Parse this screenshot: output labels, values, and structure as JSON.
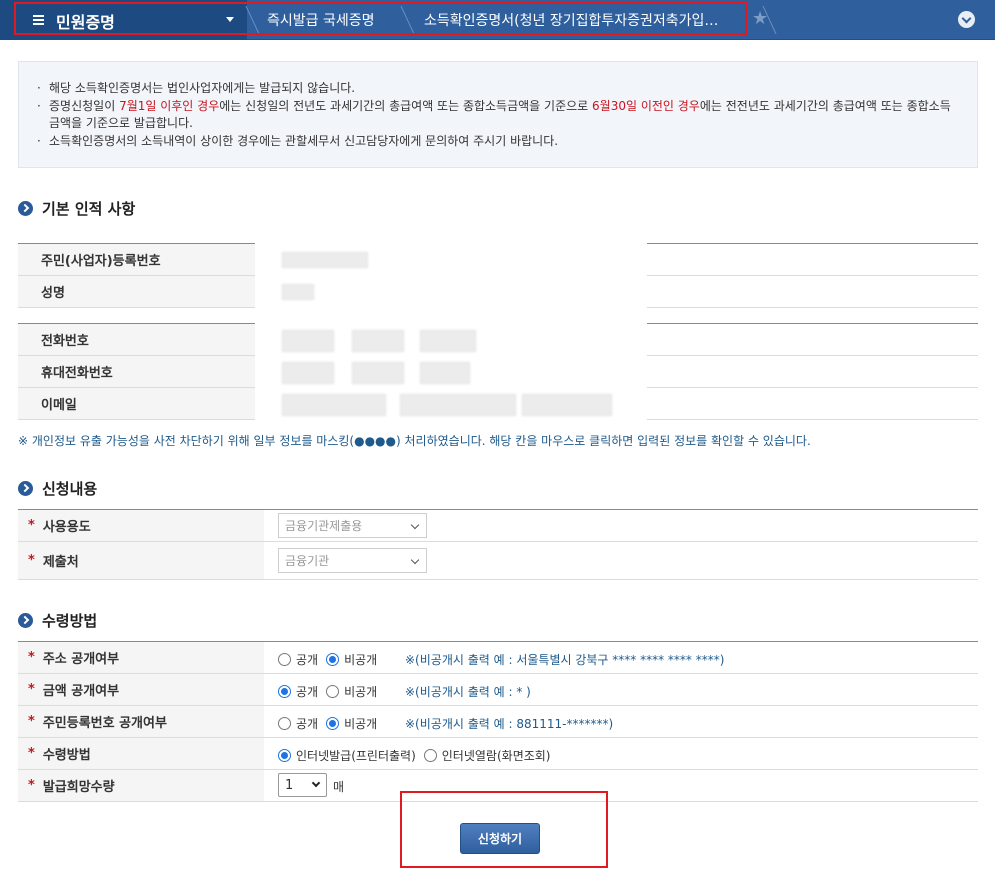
{
  "nav": {
    "main_title": "민원증명",
    "crumb1": "즉시발급 국세증명",
    "crumb2": "소득확인증명서(청년 장기집합투자증권저축가입…"
  },
  "notice": {
    "line1": "해당 소득확인증명서는 법인사업자에게는 발급되지 않습니다.",
    "line2_a": "증명신청일이 ",
    "line2_red1": "7월1일 이후인 경우",
    "line2_b": "에는 신청일의 전년도 과세기간의 총급여액 또는 종합소득금액을 기준으로 ",
    "line2_red2": "6월30일 이전인 경우",
    "line2_c": "에는 전전년도 과세기간의 총급여액 또는 종합소득금액을 기준으로 발급합니다.",
    "line3": "소득확인증명서의 소득내역이 상이한 경우에는 관할세무서 신고담당자에게 문의하여 주시기 바랍니다."
  },
  "sections": {
    "basic": "기본 인적 사항",
    "apply": "신청내용",
    "receive": "수령방법"
  },
  "basic": {
    "rrn_label": "주민(사업자)등록번호",
    "name_label": "성명",
    "phone_label": "전화번호",
    "mobile_label": "휴대전화번호",
    "email_label": "이메일",
    "mask_note": "※ 개인정보 유출 가능성을 사전 차단하기 위해 일부 정보를 마스킹(●●●●) 처리하였습니다. 해당 칸을 마우스로 클릭하면 입력된 정보를 확인할 수 있습니다."
  },
  "apply": {
    "purpose_label": "사용용도",
    "purpose_value": "금융기관제출용",
    "submit_to_label": "제출처",
    "submit_to_value": "금융기관"
  },
  "receive": {
    "required_mark": "*",
    "address_label": "주소 공개여부",
    "amount_label": "금액 공개여부",
    "rrn_disclose_label": "주민등록번호 공개여부",
    "method_label": "수령방법",
    "qty_label": "발급희망수량",
    "public": "공개",
    "private": "비공개",
    "address_hint": "※(비공개시 출력 예 : 서울특별시 강북구 **** **** **** ****)",
    "amount_hint": "※(비공개시 출력 예 : * )",
    "rrn_hint": "※(비공개시 출력 예 : 881111-*******)",
    "method_print": "인터넷발급(프린터출력)",
    "method_view": "인터넷열람(화면조회)",
    "qty_value": "1",
    "qty_unit": "매"
  },
  "submit_label": "신청하기",
  "colors": {
    "nav_bg": "#2f5f9d",
    "accent_red": "#c8141e",
    "hint_blue": "#1e5a8c"
  }
}
